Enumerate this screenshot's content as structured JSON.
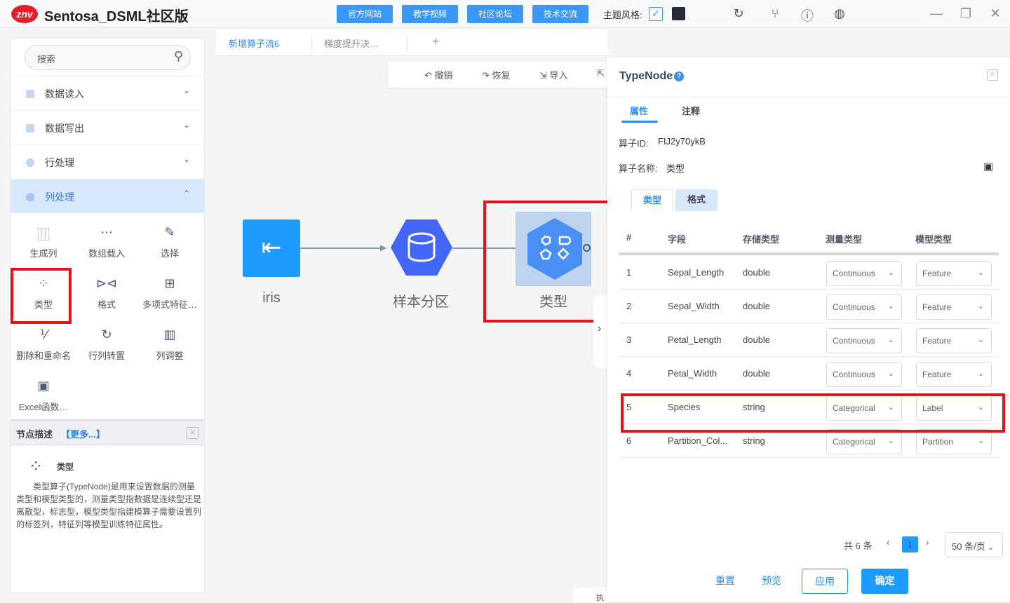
{
  "app": {
    "logo": "znv",
    "title": "Sentosa_DSML社区版"
  },
  "topnav": [
    "官方网站",
    "教学视频",
    "社区论坛",
    "技术交流"
  ],
  "theme": {
    "label": "主题风格:",
    "checked": true,
    "accent": "#3a97f5",
    "dark_swatch": "#252b3a"
  },
  "top_icons": [
    "refresh-icon",
    "branch-icon",
    "help-icon",
    "globe-icon"
  ],
  "window": {
    "minimize": "—",
    "restore": "❐",
    "close": "✕"
  },
  "left": {
    "search_placeholder": "搜索",
    "categories": [
      {
        "label": "数据读入",
        "expanded": false
      },
      {
        "label": "数据写出",
        "expanded": false
      },
      {
        "label": "行处理",
        "expanded": false
      },
      {
        "label": "列处理",
        "expanded": true
      }
    ],
    "tools": [
      {
        "label": "生成列",
        "icon": "⿲"
      },
      {
        "label": "数组载入",
        "icon": "⋯"
      },
      {
        "label": "选择",
        "icon": "✎"
      },
      {
        "label": "类型",
        "icon": "⁘"
      },
      {
        "label": "格式",
        "icon": "⊳⊲"
      },
      {
        "label": "多项式特征…",
        "icon": "⊞"
      },
      {
        "label": "删除和重命名",
        "icon": "⅟"
      },
      {
        "label": "行列转置",
        "icon": "↻"
      },
      {
        "label": "列调整",
        "icon": "▥"
      },
      {
        "label": "Excel函数…",
        "icon": "▣"
      }
    ],
    "desc": {
      "title": "节点描述",
      "more": "【更多...】",
      "node_name": "类型",
      "text": "类型算子(TypeNode)是用来设置数据的测量类型和模型类型的，测量类型指数据是连续型还是离散型，标志型，模型类型指建模算子需要设置列的标签列，特征列等模型训练特征属性。"
    }
  },
  "tabs": [
    {
      "label": "新增算子流6",
      "active": true
    },
    {
      "label": "梯度提升决…",
      "active": false
    }
  ],
  "tabs_add": "+",
  "toolbar": {
    "undo": "撤销",
    "redo": "恢复",
    "import": "导入"
  },
  "canvas": {
    "nodes": [
      {
        "label": "iris",
        "color": "#1e9bff"
      },
      {
        "label": "样本分区",
        "color": "#4466f8"
      },
      {
        "label": "类型",
        "color": "#4a8ff5"
      }
    ],
    "bottom_tab": "执"
  },
  "panel": {
    "title": "TypeNode",
    "tabs": [
      "属性",
      "注释"
    ],
    "id_label": "算子ID:",
    "id_value": "FIJ2y70ykB",
    "name_label": "算子名称:",
    "name_value": "类型",
    "subtabs": [
      "类型",
      "格式"
    ],
    "columns": [
      "#",
      "字段",
      "存储类型",
      "测量类型",
      "模型类型"
    ],
    "rows": [
      {
        "n": "1",
        "field": "Sepal_Length",
        "storage": "double",
        "measure": "Continuous",
        "model": "Feature"
      },
      {
        "n": "2",
        "field": "Sepal_Width",
        "storage": "double",
        "measure": "Continuous",
        "model": "Feature"
      },
      {
        "n": "3",
        "field": "Petal_Length",
        "storage": "double",
        "measure": "Continuous",
        "model": "Feature"
      },
      {
        "n": "4",
        "field": "Petal_Width",
        "storage": "double",
        "measure": "Continuous",
        "model": "Feature"
      },
      {
        "n": "5",
        "field": "Species",
        "storage": "string",
        "measure": "Categorical",
        "model": "Label"
      },
      {
        "n": "6",
        "field": "Partition_Col...",
        "storage": "string",
        "measure": "Categorical",
        "model": "Partition"
      }
    ],
    "pagination": {
      "total": "共 6 条",
      "page": "1",
      "page_size": "50 条/页"
    },
    "buttons": {
      "reset": "重置",
      "preview": "预览",
      "apply": "应用",
      "ok": "确定"
    }
  }
}
